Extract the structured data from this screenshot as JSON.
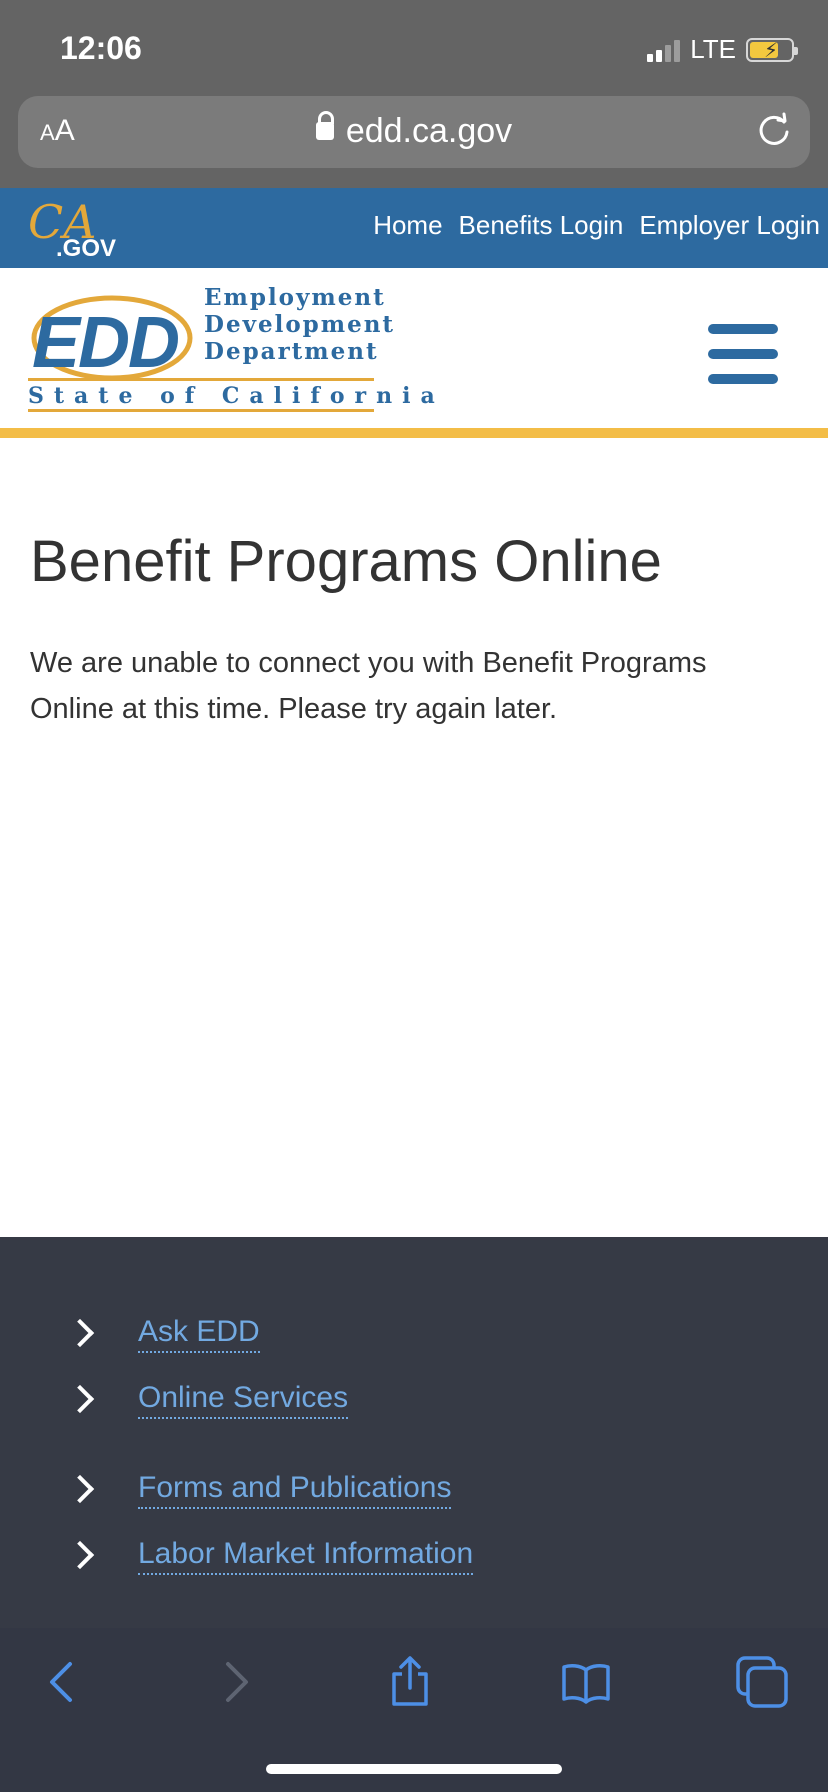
{
  "status": {
    "time": "12:06",
    "network": "LTE"
  },
  "browser": {
    "text_size_small": "A",
    "text_size_large": "A",
    "url": "edd.ca.gov"
  },
  "cagov": {
    "logo_ca": "CA",
    "logo_gov": ".GOV",
    "nav": [
      "Home",
      "Benefits Login",
      "Employer Login"
    ]
  },
  "edd": {
    "word": "EDD",
    "dept_lines": [
      "Employment",
      "Development",
      "Department"
    ],
    "state": "State of California"
  },
  "main": {
    "title": "Benefit Programs Online",
    "message": "We are unable to connect you with Benefit Programs Online at this time. Please try again later."
  },
  "footer": {
    "links": [
      "Ask EDD",
      "Online Services",
      "Forms and Publications",
      "Labor Market Information"
    ]
  },
  "colors": {
    "brand_blue": "#2d6aa0",
    "gold": "#f3bd47",
    "footer_bg": "#363a45",
    "link": "#72a9e1"
  }
}
